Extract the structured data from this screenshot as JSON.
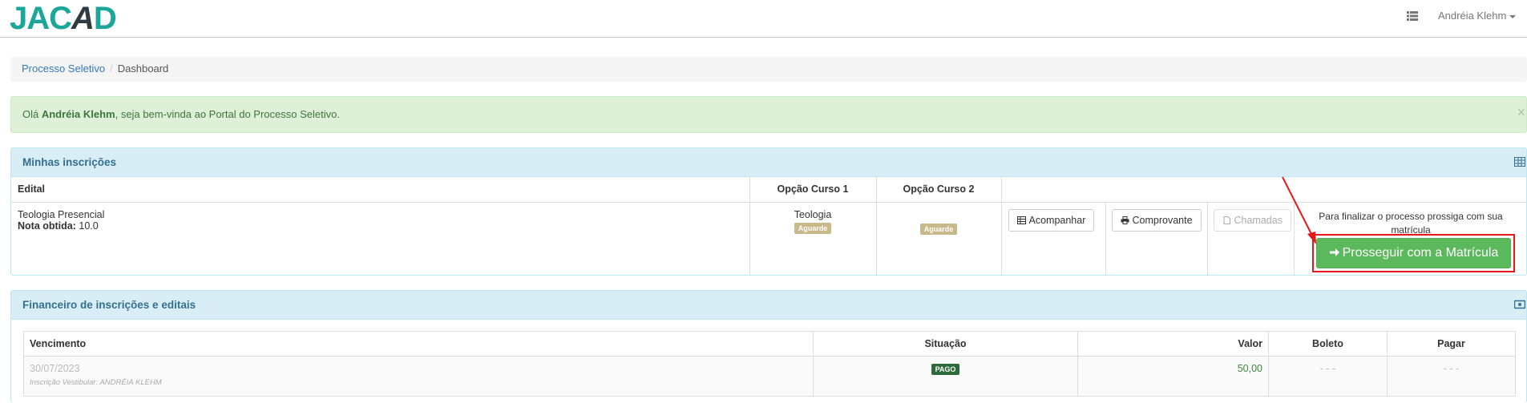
{
  "navbar": {
    "logo": {
      "part1": "JAC",
      "part2": "A",
      "part3": "D"
    },
    "user_name": "Andréia Klehm"
  },
  "breadcrumb": {
    "link": "Processo Seletivo",
    "current": "Dashboard"
  },
  "alert": {
    "prefix": "Olá ",
    "name": "Andréia Klehm",
    "suffix": ", seja bem-vinda ao Portal do Processo Seletivo.",
    "close": "×"
  },
  "inscricoes": {
    "title": "Minhas inscrições",
    "columns": {
      "edital": "Edital",
      "opcao1": "Opção Curso 1",
      "opcao2": "Opção Curso 2"
    },
    "row": {
      "edital": "Teologia Presencial",
      "nota_label": "Nota obtida:",
      "nota_value": "10.0",
      "opcao1_course": "Teologia",
      "opcao1_status": "Aguarde",
      "opcao2_status": "Aguarde",
      "btn_acompanhar": "Acompanhar",
      "btn_comprovante": "Comprovante",
      "btn_chamadas": "Chamadas",
      "finalize_text": "Para finalizar o processo prossiga com sua matrícula",
      "btn_prosseguir": "Prosseguir com a Matrícula"
    }
  },
  "financeiro": {
    "title": "Financeiro de inscrições e editais",
    "columns": {
      "vencimento": "Vencimento",
      "situacao": "Situação",
      "valor": "Valor",
      "boleto": "Boleto",
      "pagar": "Pagar"
    },
    "rows": [
      {
        "vencimento": "30/07/2023",
        "descricao": "Inscrição Vestibular: ANDRÉIA KLEHM",
        "situacao": "PAGO",
        "valor": "50,00",
        "boleto": "- - -",
        "pagar": "- - -"
      }
    ]
  },
  "colors": {
    "success": "#5cb85c",
    "info_heading": "#d9edf7",
    "alert_bg": "#dff0d8",
    "highlight": "#e3171c"
  }
}
